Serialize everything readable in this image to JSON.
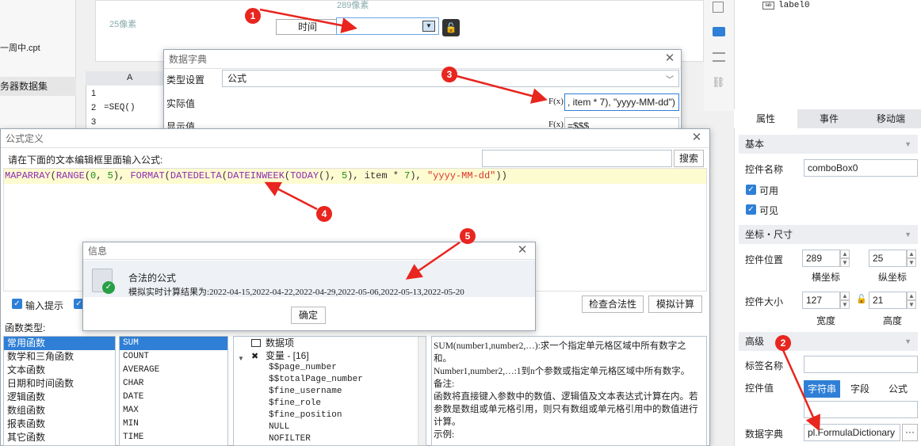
{
  "designer": {
    "files": {
      "cpt_file": "一周中.cpt",
      "server_dataset": "务器数据集"
    },
    "canvas": {
      "ruler_top": "289像素",
      "ruler_left": "25像素",
      "time_label": "时间"
    },
    "sheet": {
      "col_a": "A",
      "rows": [
        "1",
        "2",
        "3"
      ],
      "cell_a2": "=SEQ()"
    },
    "label_tree_item": "label0"
  },
  "dict_dialog": {
    "title": "数据字典",
    "type_label": "类型设置",
    "type_value": "公式",
    "actual_label": "实际值",
    "actual_value": ", item * 7), \"yyyy-MM-dd\")",
    "display_label": "显示值",
    "display_value": "=$$$",
    "fx": "F(x)"
  },
  "formula_dialog": {
    "title": "公式定义",
    "prompt": "请在下面的文本编辑框里面输入公式:",
    "search_button": "搜索",
    "formula_tokens": [
      {
        "t": "MAPARRAY",
        "c": "#8b2bb3"
      },
      {
        "t": "(",
        "c": "#333333"
      },
      {
        "t": "RANGE",
        "c": "#8b2bb3"
      },
      {
        "t": "(",
        "c": "#333333"
      },
      {
        "t": "0",
        "c": "#1a8a1a"
      },
      {
        "t": ", ",
        "c": "#333333"
      },
      {
        "t": "5",
        "c": "#1a8a1a"
      },
      {
        "t": "), ",
        "c": "#333333"
      },
      {
        "t": "FORMAT",
        "c": "#8b2bb3"
      },
      {
        "t": "(",
        "c": "#333333"
      },
      {
        "t": "DATEDELTA",
        "c": "#8b2bb3"
      },
      {
        "t": "(",
        "c": "#333333"
      },
      {
        "t": "DATEINWEEK",
        "c": "#8b2bb3"
      },
      {
        "t": "(",
        "c": "#333333"
      },
      {
        "t": "TODAY",
        "c": "#8b2bb3"
      },
      {
        "t": "(), ",
        "c": "#333333"
      },
      {
        "t": "5",
        "c": "#1a8a1a"
      },
      {
        "t": "), item * ",
        "c": "#333333"
      },
      {
        "t": "7",
        "c": "#1a8a1a"
      },
      {
        "t": "), ",
        "c": "#333333"
      },
      {
        "t": "\"yyyy-MM-dd\"",
        "c": "#d9332a"
      },
      {
        "t": "))",
        "c": "#333333"
      }
    ],
    "input_hint": "输入提示",
    "check_button": "检查合法性",
    "simulate_button": "模拟计算",
    "func_type_label": "函数类型:",
    "categories": [
      "常用函数",
      "数学和三角函数",
      "文本函数",
      "日期和时间函数",
      "逻辑函数",
      "数组函数",
      "报表函数",
      "其它函数"
    ],
    "functions": [
      "SUM",
      "COUNT",
      "AVERAGE",
      "CHAR",
      "DATE",
      "MAX",
      "MIN",
      "TIME"
    ],
    "tree": {
      "data_item": "数据项",
      "variables": "变量 - [16]",
      "vars": [
        "$$page_number",
        "$$totalPage_number",
        "$fine_username",
        "$fine_role",
        "$fine_position",
        "NULL",
        "NOFILTER"
      ]
    },
    "help_text": "SUM(number1,number2,…):求一个指定单元格区域中所有数字之和。\nNumber1,number2,…:1到n个参数或指定单元格区域中所有数字。\n备注:\n函数将直接键入参数中的数值、逻辑值及文本表达式计算在内。若参数是数组或单元格引用，则只有数组或单元格引用中的数值进行计算。\n示例:"
  },
  "info_dialog": {
    "title": "信息",
    "heading": "合法的公式",
    "result": "模拟实时计算结果为:2022-04-15,2022-04-22,2022-04-29,2022-05-06,2022-05-13,2022-05-20",
    "ok_button": "确定"
  },
  "right_panel": {
    "tabs": [
      "属性",
      "事件",
      "移动端"
    ],
    "basic": "基本",
    "name_label": "控件名称",
    "name_value": "comboBox0",
    "enabled": "可用",
    "visible": "可见",
    "coord_section": "坐标・尺寸",
    "pos_label": "控件位置",
    "pos_x": "289",
    "pos_y": "25",
    "x_label": "横坐标",
    "y_label": "纵坐标",
    "size_label": "控件大小",
    "width": "127",
    "height": "21",
    "w_label": "宽度",
    "h_label": "高度",
    "advanced": "高级",
    "tag_label": "标签名称",
    "value_label": "控件值",
    "value_tabs": [
      "字符串",
      "字段",
      "公式"
    ],
    "dict_label": "数据字典",
    "dict_value": "pl.FormulaDictionary",
    "dict_btn": "···"
  },
  "badges": [
    "1",
    "2",
    "3",
    "4",
    "5"
  ],
  "colors": {
    "accent": "#2f7fd6",
    "badge": "#e8251f",
    "formula_bg": "#fdfbd0"
  }
}
